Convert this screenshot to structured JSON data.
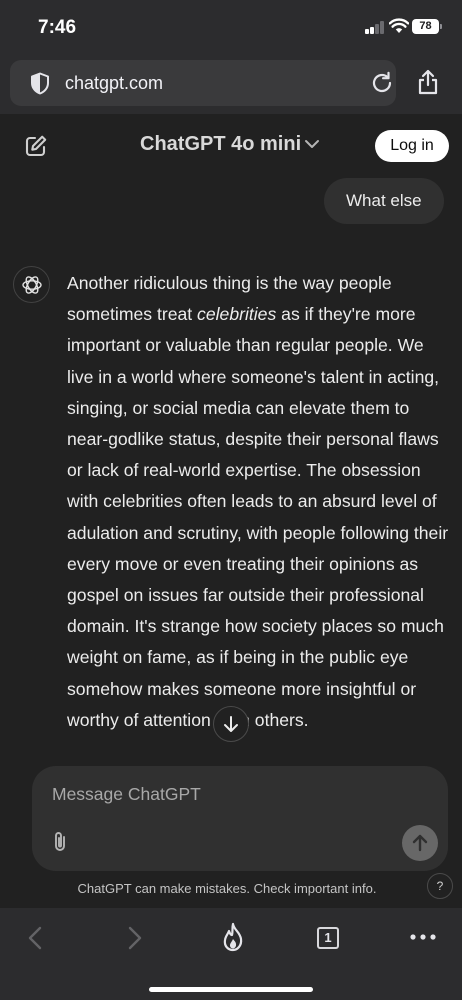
{
  "status_bar": {
    "time": "7:46",
    "battery": "78"
  },
  "browser": {
    "url": "chatgpt.com"
  },
  "header": {
    "model_name": "ChatGPT 4o mini",
    "login_label": "Log in"
  },
  "conversation": {
    "user_message": "What else",
    "assistant_intro": "Another ridiculous thing is the way people sometimes treat ",
    "assistant_emphasis": "celebrities",
    "assistant_rest": " as if they're more important or valuable than regular people. We live in a world where someone's talent in acting, singing, or social media can elevate them to near-godlike status, despite their personal flaws or lack of real-world expertise. The obsession with celebrities often leads to an absurd level of adulation and scrutiny, with people following their every move or even treating their opinions as gospel on issues far outside their professional domain. It's strange how society places so much weight on fame, as if being in the public eye somehow makes someone more insightful or worthy of attention than others."
  },
  "composer": {
    "placeholder": "Message ChatGPT"
  },
  "footer": {
    "disclaimer": "ChatGPT can make mistakes. Check important info.",
    "help_label": "?"
  },
  "toolbar": {
    "tab_count": "1"
  },
  "colors": {
    "background": "#212121",
    "bubble": "#303030",
    "browser_chrome": "#2c2c2e"
  },
  "icons": [
    "shield-icon",
    "reload-icon",
    "share-icon",
    "edit-icon",
    "chevron-down-icon",
    "chatgpt-logo-icon",
    "arrow-down-icon",
    "paperclip-icon",
    "arrow-up-icon",
    "back-icon",
    "forward-icon",
    "fire-icon",
    "more-icon"
  ]
}
